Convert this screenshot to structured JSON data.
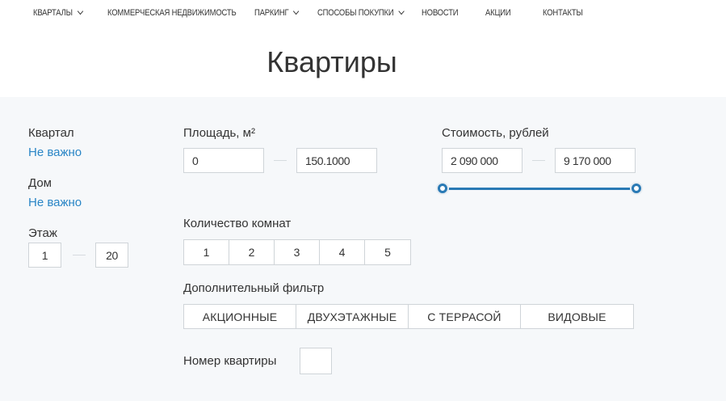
{
  "nav": {
    "items": [
      {
        "label": "Кварталы",
        "dropdown": true
      },
      {
        "label": "Коммерческая недвижимость",
        "dropdown": false
      },
      {
        "label": "Паркинг",
        "dropdown": true
      },
      {
        "label": "Способы покупки",
        "dropdown": true
      },
      {
        "label": "Новости",
        "dropdown": false
      },
      {
        "label": "Акции",
        "dropdown": false
      },
      {
        "label": "Контакты",
        "dropdown": false
      }
    ]
  },
  "page": {
    "title": "Квартиры"
  },
  "filters": {
    "quarter": {
      "label": "Квартал",
      "value": "Не важно"
    },
    "house": {
      "label": "Дом",
      "value": "Не важно"
    },
    "floor": {
      "label": "Этаж",
      "from": "1",
      "to": "20"
    },
    "area": {
      "label": "Площадь, м²",
      "from": "0",
      "to": "150.1000"
    },
    "price": {
      "label": "Стоимость, рублей",
      "from": "2 090 000",
      "to": "9 170 000",
      "slider_min_fraction": 0.0,
      "slider_max_fraction": 1.0
    },
    "rooms": {
      "label": "Количество комнат",
      "options": [
        "1",
        "2",
        "3",
        "4",
        "5"
      ]
    },
    "extra": {
      "label": "Дополнительный фильтр",
      "options": [
        "Акционные",
        "Двухэтажные",
        "С террасой",
        "Видовые"
      ]
    },
    "apartment_number": {
      "label": "Номер квартиры",
      "value": ""
    }
  },
  "colors": {
    "accent": "#2a7ab5",
    "link": "#2a86c6",
    "panel_bg": "#f6f8fa",
    "border": "#cfd4d8"
  }
}
